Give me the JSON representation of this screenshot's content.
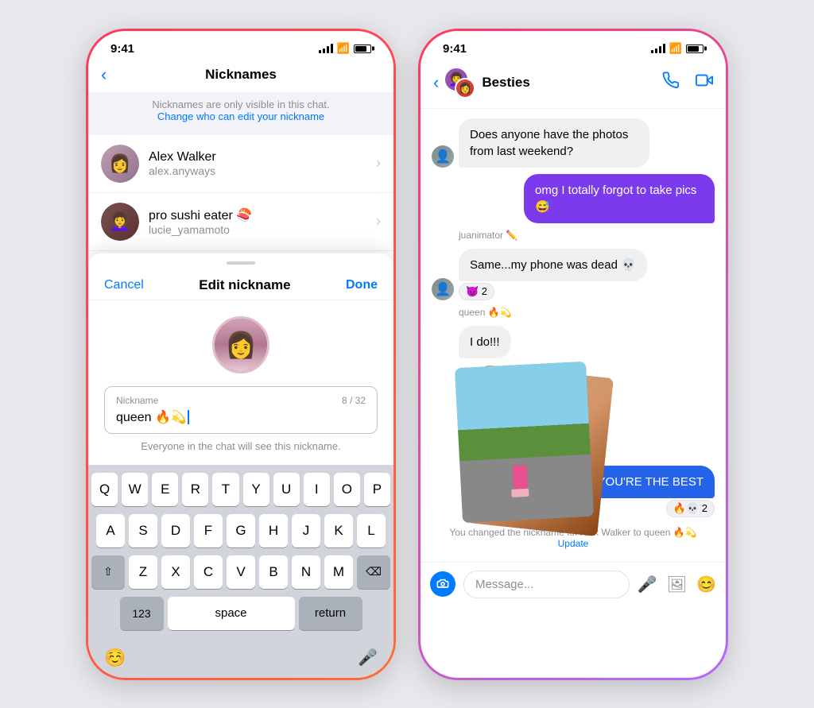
{
  "left_phone": {
    "status_bar": {
      "time": "9:41"
    },
    "header": {
      "title": "Nicknames",
      "back_label": "‹"
    },
    "info": {
      "text": "Nicknames are only visible in this chat.",
      "link": "Change who can edit your nickname"
    },
    "users": [
      {
        "name": "Alex Walker",
        "username": "alex.anyways",
        "emoji": ""
      },
      {
        "name": "pro sushi eater 🍣",
        "username": "lucie_yamamoto",
        "emoji": ""
      }
    ],
    "bottom_sheet": {
      "cancel_label": "Cancel",
      "title": "Edit nickname",
      "done_label": "Done",
      "input_label": "Nickname",
      "input_value": "queen 🔥💫",
      "input_placeholder": "Nickname",
      "counter": "8 / 32",
      "hint": "Everyone in the chat will see this nickname."
    },
    "keyboard": {
      "rows": [
        [
          "Q",
          "W",
          "E",
          "R",
          "T",
          "Y",
          "U",
          "I",
          "O",
          "P"
        ],
        [
          "A",
          "S",
          "D",
          "F",
          "G",
          "H",
          "J",
          "K",
          "L"
        ],
        [
          "Z",
          "X",
          "C",
          "V",
          "B",
          "N",
          "M"
        ]
      ],
      "special": {
        "shift": "⇧",
        "delete": "⌫",
        "num": "123",
        "space": "space",
        "return": "return"
      }
    }
  },
  "right_phone": {
    "status_bar": {
      "time": "9:41"
    },
    "header": {
      "title": "Besties",
      "back_label": "‹",
      "call_icon": "📞",
      "video_icon": "📹"
    },
    "messages": [
      {
        "type": "received",
        "text": "Does anyone have the photos from last weekend?",
        "sender": "avatar_gray"
      },
      {
        "type": "sent",
        "text": "omg I totally forgot to take pics 😅",
        "variant": "purple"
      },
      {
        "type": "sender_label",
        "text": "juanimator ✏️"
      },
      {
        "type": "received",
        "text": "Same...my phone was dead 💀",
        "has_reaction": true,
        "reaction": "😈 2",
        "sender": "avatar_gray"
      },
      {
        "type": "sender_label",
        "text": "queen 🔥💫"
      },
      {
        "type": "received",
        "text": "I do!!!",
        "sender": null
      },
      {
        "type": "photo_stack",
        "sender": null
      },
      {
        "type": "sent",
        "text": "ALEX YOU'RE THE BEST",
        "variant": "blue",
        "has_reaction": true,
        "reaction": "🔥💀 2",
        "sender": "avatar_pink"
      },
      {
        "type": "status",
        "text": "You changed the nickname for Alex Walker to queen 🔥💫",
        "link": "Update"
      }
    ],
    "input_bar": {
      "placeholder": "Message...",
      "camera_icon": "📷",
      "mic_icon": "🎤",
      "photo_icon": "🖼",
      "sticker_icon": "😊"
    }
  }
}
